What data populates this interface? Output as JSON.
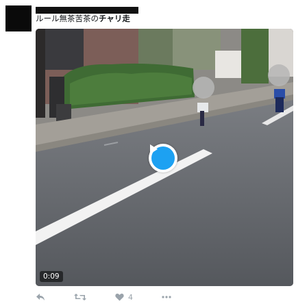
{
  "tweet": {
    "text_prefix": "ルール無茶苦茶の",
    "text_bold": "チャリ走"
  },
  "media": {
    "duration": "0:09",
    "play_label": "play"
  },
  "actions": {
    "reply_icon": "reply-icon",
    "retweet_icon": "retweet-icon",
    "like_icon": "heart-icon",
    "like_count": "4",
    "more_icon": "more-icon"
  },
  "colors": {
    "accent": "#1da1f2",
    "icon_gray": "#9aa3ab"
  }
}
